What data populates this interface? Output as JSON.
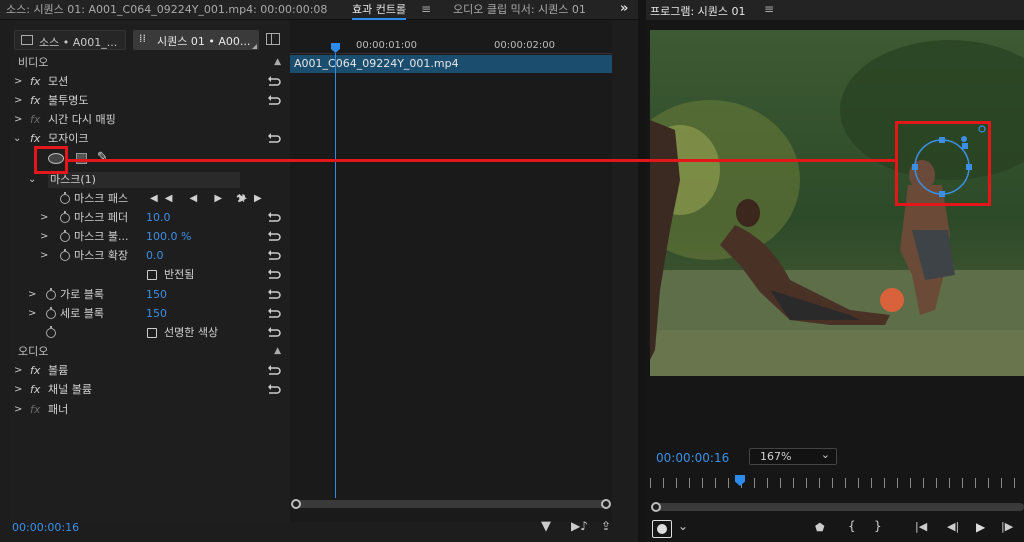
{
  "top_left": {
    "source_tab": "소스: 시퀀스 01: A001_C064_09224Y_001.mp4: 00:00:00:08",
    "effect_tab": "효과 컨트롤",
    "mixer_tab": "오디오 클립 믹서: 시퀀스 01"
  },
  "program": {
    "title": "프로그램: 시퀀스 01",
    "timecode": "00:00:00:16",
    "zoom": "167%"
  },
  "effect_controls": {
    "source_chip": "소스 • A001_...",
    "seq_chip": "시퀀스 01 • A00...",
    "ruler": [
      "00:00:01:00",
      "00:00:02:00"
    ],
    "clip_name": "A001_C064_09224Y_001.mp4",
    "video_label": "비디오",
    "audio_label": "오디오",
    "motion": "모션",
    "opacity": "불투명도",
    "time_remap": "시간 다시 매핑",
    "mosaic": "모자이크",
    "mask": "마스크(1)",
    "mask_path": "마스크 패스",
    "mask_feather": "마스크 페더",
    "mask_feather_val": "10.0",
    "mask_opacity": "마스크 불...",
    "mask_opacity_val": "100.0 %",
    "mask_expansion": "마스크 확장",
    "mask_expansion_val": "0.0",
    "inverted": "반전됨",
    "h_blocks": "가로 블록",
    "h_blocks_val": "150",
    "v_blocks": "세로 블록",
    "v_blocks_val": "150",
    "sharp_colors": "선명한 색상",
    "volume": "볼륨",
    "channel_volume": "채널 볼륨",
    "panner": "패너",
    "bottom_timecode": "00:00:00:16"
  },
  "icons": {
    "fx": "fx",
    "chevron_right": "›",
    "chevron_down": "⌄"
  }
}
